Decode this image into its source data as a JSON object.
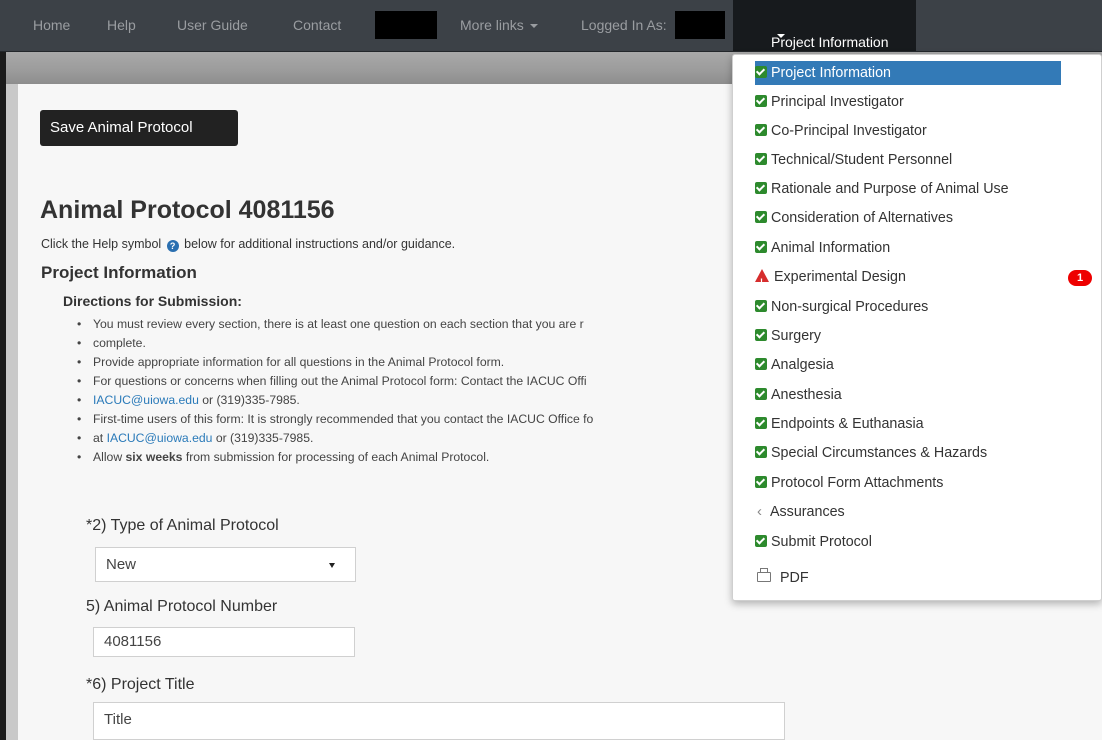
{
  "nav": {
    "home": "Home",
    "help": "Help",
    "user_guide": "User Guide",
    "contact": "Contact",
    "more_links": "More links",
    "logged_in_as": "Logged In As:",
    "project_information": "Project Information"
  },
  "toolbar": {
    "save_label": "Save Animal Protocol"
  },
  "page": {
    "title": "Animal Protocol 4081156",
    "help_before": "Click the Help symbol",
    "help_after": "below for additional instructions and/or guidance.",
    "section_title": "Project Information",
    "directions_title": "Directions for Submission:"
  },
  "directions": {
    "item1_line1": "You must review every section, there is at least one question on each section that you are r",
    "item1_line2": "complete.",
    "item2": "Provide appropriate information for all questions in the Animal Protocol form.",
    "item3_line1": "For questions or concerns when filling out the Animal Protocol form: Contact the IACUC Offi",
    "item3_link": "IACUC@uiowa.edu",
    "item3_after": "or (319)335-7985.",
    "item4_line1": "First-time users of this form: It is strongly recommended that you contact the IACUC Office fo",
    "item4_before": "at",
    "item4_link": "IACUC@uiowa.edu",
    "item4_after": "or (319)335-7985.",
    "item5_before": "Allow",
    "item5_bold": "six weeks",
    "item5_after": "from submission for processing of each Animal Protocol."
  },
  "form": {
    "q2_label": "*2) Type of Animal Protocol",
    "q2_value": "New",
    "q5_label": "5) Animal Protocol Number",
    "q5_value": "4081156",
    "q6_label": "*6) Project Title",
    "q6_value": "Title"
  },
  "menu": {
    "items": [
      {
        "label": "Project Information",
        "status": "complete"
      },
      {
        "label": "Principal Investigator",
        "status": "complete"
      },
      {
        "label": "Co-Principal Investigator",
        "status": "complete"
      },
      {
        "label": "Technical/Student Personnel",
        "status": "complete"
      },
      {
        "label": "Rationale and Purpose of Animal Use",
        "status": "complete"
      },
      {
        "label": "Consideration of Alternatives",
        "status": "complete"
      },
      {
        "label": "Animal Information",
        "status": "complete"
      },
      {
        "label": "Experimental Design",
        "status": "warning"
      },
      {
        "label": "Non-surgical Procedures",
        "status": "complete"
      },
      {
        "label": "Surgery",
        "status": "complete"
      },
      {
        "label": "Analgesia",
        "status": "complete"
      },
      {
        "label": "Anesthesia",
        "status": "complete"
      },
      {
        "label": "Endpoints & Euthanasia",
        "status": "complete"
      },
      {
        "label": "Special Circumstances & Hazards",
        "status": "complete"
      },
      {
        "label": "Protocol Form Attachments",
        "status": "complete"
      },
      {
        "label": "Assurances",
        "status": "in-progress"
      },
      {
        "label": "Submit Protocol",
        "status": "complete"
      },
      {
        "label": "PDF",
        "status": "pdf"
      }
    ],
    "warning_badge": "1"
  },
  "colors": {
    "navbar": "#3c4147",
    "active_nav": "#171a1d",
    "active_menu": "#337ab7",
    "check_green": "#2d8a2d",
    "warning_red": "#d62d2d",
    "link": "#2a7ab9"
  }
}
